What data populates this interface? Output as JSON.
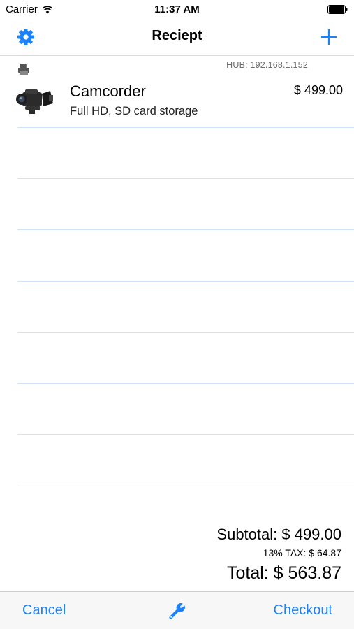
{
  "status_bar": {
    "carrier": "Carrier",
    "time": "11:37 AM",
    "icons": [
      "wifi-icon",
      "battery-icon"
    ]
  },
  "nav": {
    "title": "Reciept",
    "left_icon": "gear-icon",
    "right_icon": "plus-icon"
  },
  "hub": {
    "icon": "printer-icon",
    "label": "HUB: 192.168.1.152"
  },
  "items": [
    {
      "image": "camcorder-image",
      "name": "Camcorder",
      "description": "Full HD, SD card storage",
      "price": "$ 499.00"
    }
  ],
  "summary": {
    "subtotal": "Subtotal: $ 499.00",
    "tax": "13% TAX: $ 64.87",
    "total": "Total: $ 563.87"
  },
  "toolbar": {
    "cancel_label": "Cancel",
    "middle_icon": "wrench-icon",
    "checkout_label": "Checkout"
  },
  "colors": {
    "accent": "#1a82fb",
    "divider": "#cfe2f7"
  }
}
